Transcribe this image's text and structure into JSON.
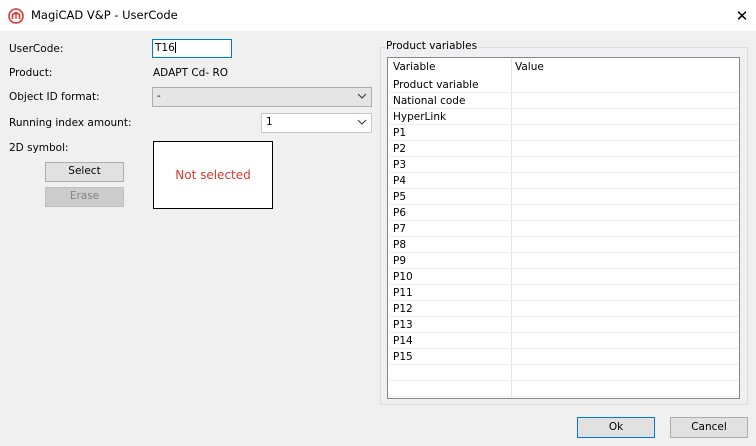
{
  "window": {
    "title": "MagiCAD V&P - UserCode",
    "close_glyph": "✕",
    "icon": "magicad-logo-icon",
    "accent": "#0078d7"
  },
  "form": {
    "usercode_label": "UserCode:",
    "usercode_value": "T16",
    "product_label": "Product:",
    "product_value": "ADAPT Cd- RO",
    "object_id_format_label": "Object ID format:",
    "object_id_format_value": "-",
    "running_index_label": "Running index amount:",
    "running_index_value": "1",
    "symbol_label": "2D symbol:",
    "select_button": "Select",
    "erase_button": "Erase",
    "symbol_placeholder": "Not selected"
  },
  "product_variables": {
    "group_title": "Product variables",
    "columns": [
      "Variable",
      "Value"
    ],
    "rows": [
      {
        "variable": "Product variable",
        "value": ""
      },
      {
        "variable": "National code",
        "value": ""
      },
      {
        "variable": "HyperLink",
        "value": ""
      },
      {
        "variable": "P1",
        "value": ""
      },
      {
        "variable": "P2",
        "value": ""
      },
      {
        "variable": "P3",
        "value": ""
      },
      {
        "variable": "P4",
        "value": ""
      },
      {
        "variable": "P5",
        "value": ""
      },
      {
        "variable": "P6",
        "value": ""
      },
      {
        "variable": "P7",
        "value": ""
      },
      {
        "variable": "P8",
        "value": ""
      },
      {
        "variable": "P9",
        "value": ""
      },
      {
        "variable": "P10",
        "value": ""
      },
      {
        "variable": "P11",
        "value": ""
      },
      {
        "variable": "P12",
        "value": ""
      },
      {
        "variable": "P13",
        "value": ""
      },
      {
        "variable": "P14",
        "value": ""
      },
      {
        "variable": "P15",
        "value": ""
      },
      {
        "variable": "",
        "value": ""
      },
      {
        "variable": "",
        "value": ""
      }
    ]
  },
  "footer": {
    "ok_button": "Ok",
    "cancel_button": "Cancel"
  }
}
